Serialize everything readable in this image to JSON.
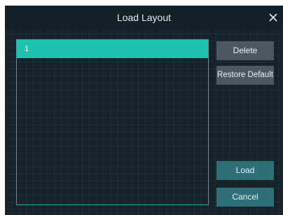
{
  "dialog": {
    "title": "Load Layout",
    "close_icon": "close-icon"
  },
  "layouts": {
    "items": [
      {
        "label": "1",
        "selected": true
      }
    ]
  },
  "buttons": {
    "delete": "Delete",
    "restore_default": "Restore Default",
    "load": "Load",
    "cancel": "Cancel"
  },
  "colors": {
    "background": "#16232b",
    "accent": "#1ec1ad",
    "button_grey": "#4b5a62",
    "button_teal": "#2f6f77"
  }
}
